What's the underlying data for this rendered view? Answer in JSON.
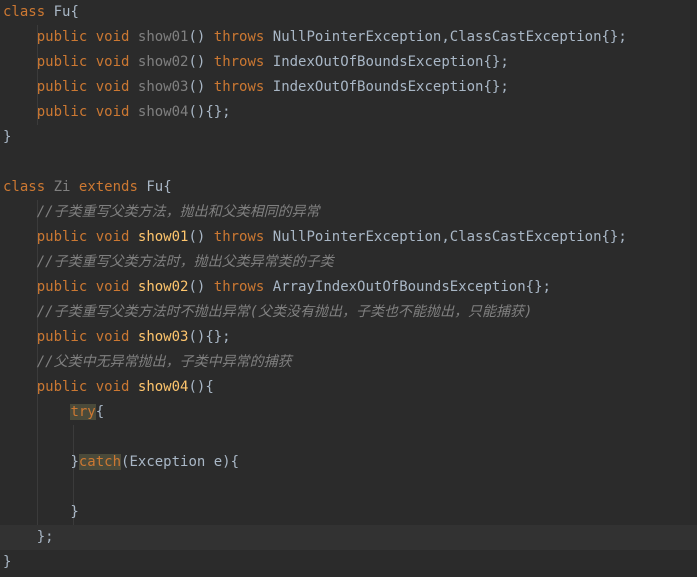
{
  "lines": [
    {
      "kind": "class",
      "kw": "class",
      "name": "Fu",
      "rest": "{"
    },
    {
      "kind": "method",
      "indent": "    ",
      "mod": "public",
      "ret": "void",
      "name": "show01",
      "sig": "() ",
      "thr": "throws",
      "tail": " NullPointerException,ClassCastException{};",
      "nameStyle": "unused"
    },
    {
      "kind": "method",
      "indent": "    ",
      "mod": "public",
      "ret": "void",
      "name": "show02",
      "sig": "() ",
      "thr": "throws",
      "tail": " IndexOutOfBoundsException{};",
      "nameStyle": "unused"
    },
    {
      "kind": "method",
      "indent": "    ",
      "mod": "public",
      "ret": "void",
      "name": "show03",
      "sig": "() ",
      "thr": "throws",
      "tail": " IndexOutOfBoundsException{};",
      "nameStyle": "unused"
    },
    {
      "kind": "method",
      "indent": "    ",
      "mod": "public",
      "ret": "void",
      "name": "show04",
      "sig": "(){};",
      "thr": "",
      "tail": "",
      "nameStyle": "unused"
    },
    {
      "kind": "plain",
      "text": "}"
    },
    {
      "kind": "plain",
      "text": ""
    },
    {
      "kind": "subclass",
      "kw": "class",
      "name": "Zi",
      "ext": "extends",
      "parent": "Fu",
      "rest": "{"
    },
    {
      "kind": "comment",
      "indent": "    ",
      "text": "//子类重写父类方法，抛出和父类相同的异常"
    },
    {
      "kind": "method",
      "indent": "    ",
      "mod": "public",
      "ret": "void",
      "name": "show01",
      "sig": "() ",
      "thr": "throws",
      "tail": " NullPointerException,ClassCastException{};",
      "nameStyle": "decl"
    },
    {
      "kind": "comment",
      "indent": "    ",
      "text": "//子类重写父类方法时，抛出父类异常类的子类"
    },
    {
      "kind": "method",
      "indent": "    ",
      "mod": "public",
      "ret": "void",
      "name": "show02",
      "sig": "() ",
      "thr": "throws",
      "tail": " ArrayIndexOutOfBoundsException{};",
      "nameStyle": "decl"
    },
    {
      "kind": "comment",
      "indent": "    ",
      "text": "//子类重写父类方法时不抛出异常(父类没有抛出，子类也不能抛出，只能捕获)"
    },
    {
      "kind": "method",
      "indent": "    ",
      "mod": "public",
      "ret": "void",
      "name": "show03",
      "sig": "(){};",
      "thr": "",
      "tail": "",
      "nameStyle": "decl"
    },
    {
      "kind": "comment",
      "indent": "    ",
      "text": "//父类中无异常抛出，子类中异常的捕获"
    },
    {
      "kind": "method",
      "indent": "    ",
      "mod": "public",
      "ret": "void",
      "name": "show04",
      "sig": "(){",
      "thr": "",
      "tail": "",
      "nameStyle": "decl"
    },
    {
      "kind": "try",
      "indent": "        ",
      "kw": "try",
      "rest": "{"
    },
    {
      "kind": "plain",
      "text": ""
    },
    {
      "kind": "catch",
      "indent": "        ",
      "pre": "}",
      "kw": "catch",
      "rest": "(Exception e){"
    },
    {
      "kind": "plain",
      "text": ""
    },
    {
      "kind": "plain",
      "text": "        }"
    },
    {
      "kind": "plain",
      "text": "    };",
      "current": true
    },
    {
      "kind": "plain",
      "text": "}"
    }
  ],
  "colors": {
    "background": "#2b2b2b",
    "keyword": "#cc7832",
    "method_decl": "#ffc66d",
    "unused": "#808080",
    "text": "#a9b7c6"
  }
}
